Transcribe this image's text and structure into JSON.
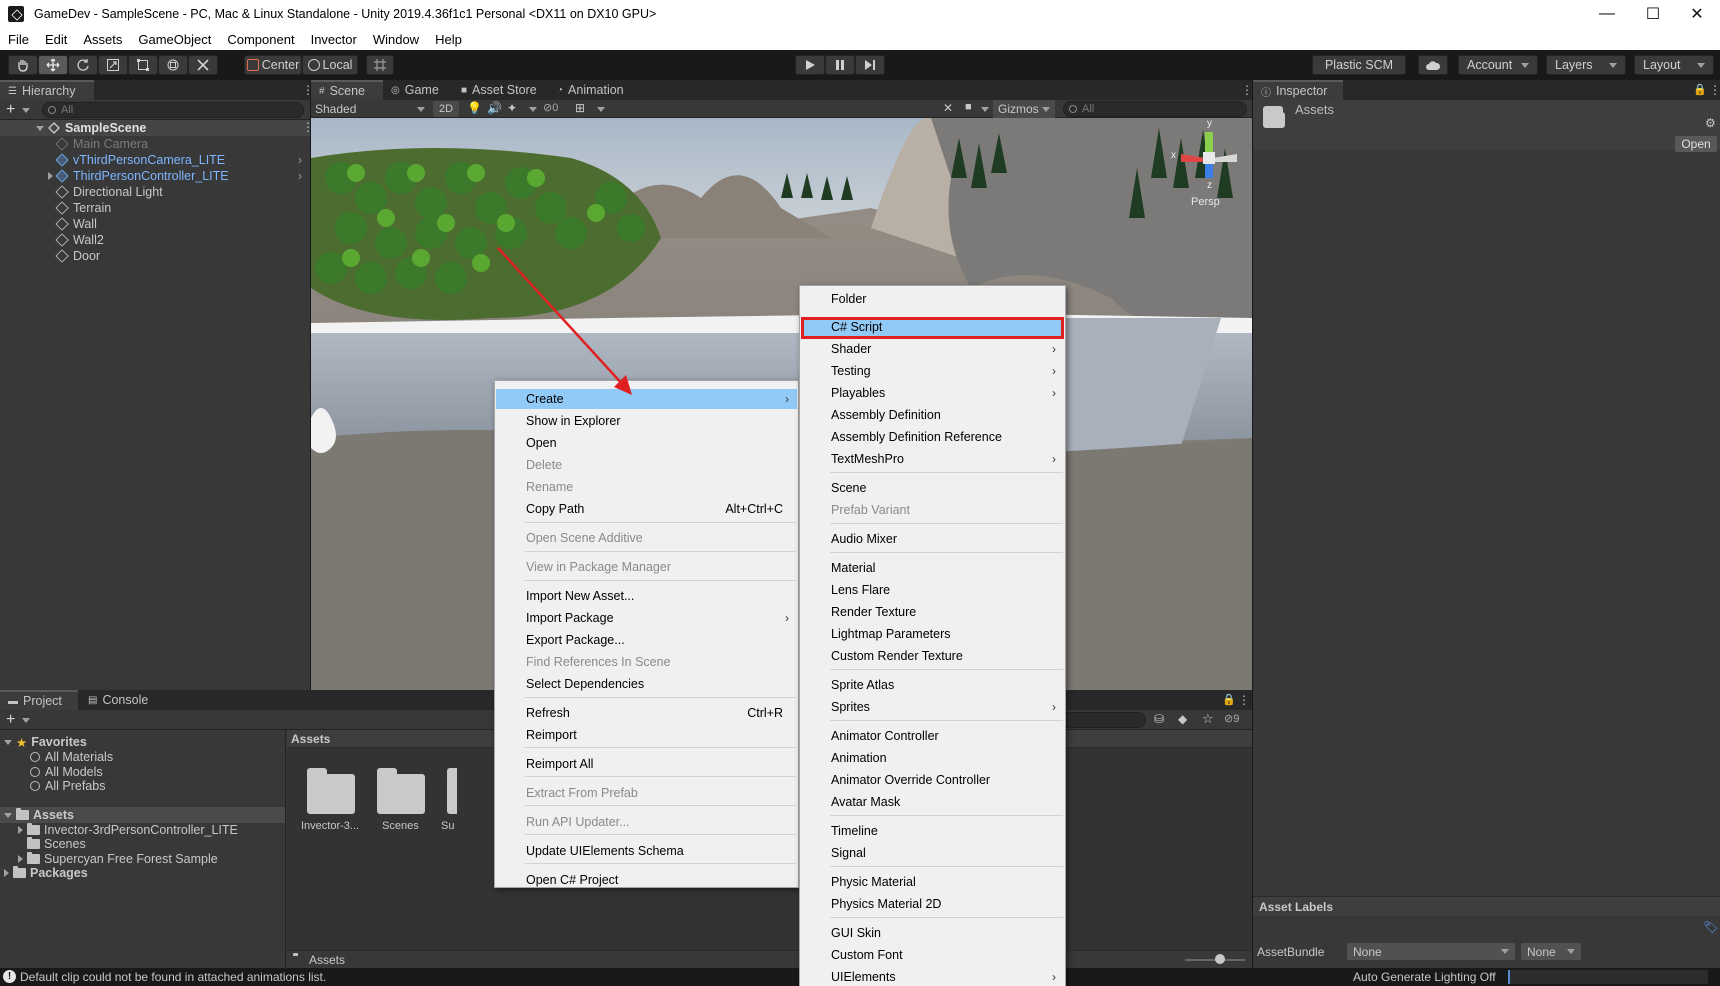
{
  "window": {
    "title": "GameDev - SampleScene - PC, Mac & Linux Standalone - Unity 2019.4.36f1c1 Personal <DX11 on DX10 GPU>",
    "minimize": "—",
    "maximize": "☐",
    "close": "✕"
  },
  "menu": [
    "File",
    "Edit",
    "Assets",
    "GameObject",
    "Component",
    "Invector",
    "Window",
    "Help"
  ],
  "toolbar": {
    "pivot": "Center",
    "space": "Local",
    "plastic": "Plastic SCM",
    "account": "Account",
    "layers": "Layers",
    "layout": "Layout"
  },
  "hierarchy": {
    "tab": "Hierarchy",
    "search_placeholder": "All",
    "scene": "SampleScene",
    "items": [
      {
        "label": "Main Camera",
        "style": "dim"
      },
      {
        "label": "vThirdPersonCamera_LITE",
        "style": "prefab"
      },
      {
        "label": "ThirdPersonController_LITE",
        "style": "prefab"
      },
      {
        "label": "Directional Light",
        "style": "normal"
      },
      {
        "label": "Terrain",
        "style": "normal"
      },
      {
        "label": "Wall",
        "style": "normal"
      },
      {
        "label": "Wall2",
        "style": "normal"
      },
      {
        "label": "Door",
        "style": "normal"
      }
    ]
  },
  "scene_tabs": {
    "scene": "Scene",
    "game": "Game",
    "asset_store": "Asset Store",
    "animation": "Animation"
  },
  "scene_toolbar": {
    "shading": "Shaded",
    "mode_2d": "2D",
    "hidden_count": "0",
    "gizmos": "Gizmos",
    "search_placeholder": "All",
    "persp": "Persp",
    "axis_x": "x",
    "axis_y": "y",
    "axis_z": "z"
  },
  "inspector": {
    "tab": "Inspector",
    "asset_name": "Assets",
    "open_button": "Open",
    "asset_labels": "Asset Labels",
    "asset_bundle": "AssetBundle",
    "bundle_value": "None",
    "bundle_variant": "None"
  },
  "project": {
    "tab_project": "Project",
    "tab_console": "Console",
    "favorites": "Favorites",
    "fav_items": [
      "All Materials",
      "All Models",
      "All Prefabs"
    ],
    "assets_root": "Assets",
    "asset_folders": [
      "Invector-3rdPersonController_LITE",
      "Scenes",
      "Supercyan Free Forest Sample"
    ],
    "packages": "Packages",
    "grid_header": "Assets",
    "grid_items": [
      "Invector-3...",
      "Scenes",
      "Su"
    ],
    "breadcrumb": "Assets",
    "hidden_count": "9"
  },
  "context_menu": {
    "items": [
      {
        "label": "Create",
        "state": "highlight",
        "submenu": true
      },
      {
        "label": "Show in Explorer",
        "state": "enabled"
      },
      {
        "label": "Open",
        "state": "enabled"
      },
      {
        "label": "Delete",
        "state": "disabled"
      },
      {
        "label": "Rename",
        "state": "disabled"
      },
      {
        "label": "Copy Path",
        "state": "enabled",
        "shortcut": "Alt+Ctrl+C"
      },
      {
        "label": "Open Scene Additive",
        "state": "disabled"
      },
      {
        "label": "View in Package Manager",
        "state": "disabled"
      },
      {
        "label": "Import New Asset...",
        "state": "enabled"
      },
      {
        "label": "Import Package",
        "state": "enabled",
        "submenu": true
      },
      {
        "label": "Export Package...",
        "state": "enabled"
      },
      {
        "label": "Find References In Scene",
        "state": "disabled"
      },
      {
        "label": "Select Dependencies",
        "state": "enabled"
      },
      {
        "label": "Refresh",
        "state": "enabled",
        "shortcut": "Ctrl+R"
      },
      {
        "label": "Reimport",
        "state": "enabled"
      },
      {
        "label": "Reimport All",
        "state": "enabled"
      },
      {
        "label": "Extract From Prefab",
        "state": "disabled"
      },
      {
        "label": "Run API Updater...",
        "state": "disabled"
      },
      {
        "label": "Update UIElements Schema",
        "state": "enabled"
      },
      {
        "label": "Open C# Project",
        "state": "enabled"
      }
    ]
  },
  "create_submenu": {
    "items": [
      {
        "label": "Folder",
        "state": "enabled"
      },
      {
        "label": "C# Script",
        "state": "highlight"
      },
      {
        "label": "Shader",
        "state": "enabled",
        "submenu": true
      },
      {
        "label": "Testing",
        "state": "enabled",
        "submenu": true
      },
      {
        "label": "Playables",
        "state": "enabled",
        "submenu": true
      },
      {
        "label": "Assembly Definition",
        "state": "enabled"
      },
      {
        "label": "Assembly Definition Reference",
        "state": "enabled"
      },
      {
        "label": "TextMeshPro",
        "state": "enabled",
        "submenu": true
      },
      {
        "label": "Scene",
        "state": "enabled"
      },
      {
        "label": "Prefab Variant",
        "state": "disabled"
      },
      {
        "label": "Audio Mixer",
        "state": "enabled"
      },
      {
        "label": "Material",
        "state": "enabled"
      },
      {
        "label": "Lens Flare",
        "state": "enabled"
      },
      {
        "label": "Render Texture",
        "state": "enabled"
      },
      {
        "label": "Lightmap Parameters",
        "state": "enabled"
      },
      {
        "label": "Custom Render Texture",
        "state": "enabled"
      },
      {
        "label": "Sprite Atlas",
        "state": "enabled"
      },
      {
        "label": "Sprites",
        "state": "enabled",
        "submenu": true
      },
      {
        "label": "Animator Controller",
        "state": "enabled"
      },
      {
        "label": "Animation",
        "state": "enabled"
      },
      {
        "label": "Animator Override Controller",
        "state": "enabled"
      },
      {
        "label": "Avatar Mask",
        "state": "enabled"
      },
      {
        "label": "Timeline",
        "state": "enabled"
      },
      {
        "label": "Signal",
        "state": "enabled"
      },
      {
        "label": "Physic Material",
        "state": "enabled"
      },
      {
        "label": "Physics Material 2D",
        "state": "enabled"
      },
      {
        "label": "GUI Skin",
        "state": "enabled"
      },
      {
        "label": "Custom Font",
        "state": "enabled"
      },
      {
        "label": "UIElements",
        "state": "enabled",
        "submenu": true
      }
    ]
  },
  "status": {
    "message": "Default clip could not be found in attached animations list.",
    "lighting": "Auto Generate Lighting Off"
  },
  "colors": {
    "highlight": "#91c9f7",
    "annotation_red": "#e02020",
    "prefab_blue": "#7eb6ff"
  }
}
